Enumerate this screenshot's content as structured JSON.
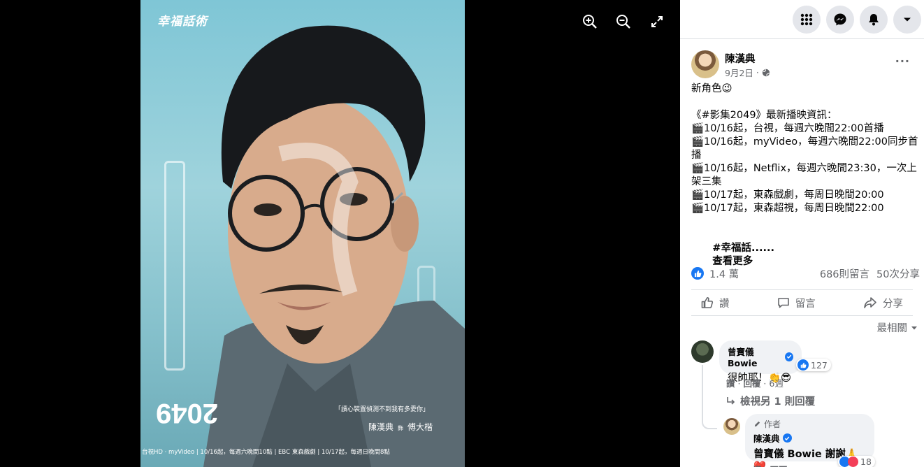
{
  "viewer": {
    "tools": [
      {
        "name": "zoom-in-icon"
      },
      {
        "name": "zoom-out-icon"
      },
      {
        "name": "fullscreen-icon"
      }
    ],
    "poster": {
      "logo_text": "幸福話術",
      "title_text": "2049",
      "tagline": "「讀心裝置偵測不到我有多愛你」",
      "cast": "陳漢典",
      "cast_connector": "飾",
      "role": "傅大楷",
      "broadcast_bar": "台視HD · myVideo | 10/16起，每週六晚間10點 | EBC 東森戲劇 | 10/17起，每週日晚間8點"
    }
  },
  "topbar": {
    "buttons": [
      "menu-grid-icon",
      "messenger-icon",
      "notifications-icon",
      "account-dropdown-icon"
    ]
  },
  "post": {
    "author": "陳漢典",
    "date": "9月2日",
    "date_separator": "·",
    "more_label": "···",
    "lines": [
      "新角色😉",
      "",
      "《#影集2049》最新播映資訊：",
      "🎬10/16起，台視，每週六晚間22:00首播",
      "🎬10/16起，myVideo，每週六晚間22:00同步首播",
      "🎬10/16起，Netflix，每週六晚間23:30，一次上架三集",
      "🎬10/17起，東森戲劇，每周日晚間20:00",
      "🎬10/17起，東森超視，每周日晚間22:00",
      ""
    ],
    "hashtag_tail": "#幸福話......",
    "see_more": "查看更多",
    "likes": "1.4 萬",
    "comments_count": "686則留言",
    "shares_count": "50次分享",
    "actions": {
      "like": "讚",
      "comment": "留言",
      "share": "分享"
    },
    "sort_label": "最相關"
  },
  "comments": [
    {
      "author": "曾寶儀 Bowie",
      "text": "很帥耶！👏😎",
      "reactions": "127",
      "meta_like": "讚",
      "meta_reply": "回覆",
      "meta_time": "6週",
      "view_replies": "檢視另 1 則回覆"
    }
  ],
  "reply": {
    "badge": "作者",
    "author": "陳漢典",
    "text": "曾寶儀 Bowie 謝謝🙏❤️",
    "reactions": "18",
    "meta_like": "讚",
    "meta_reply": "回覆"
  },
  "colors": {
    "brand": "#1877f2",
    "poster_bg": "#86c1cc"
  }
}
